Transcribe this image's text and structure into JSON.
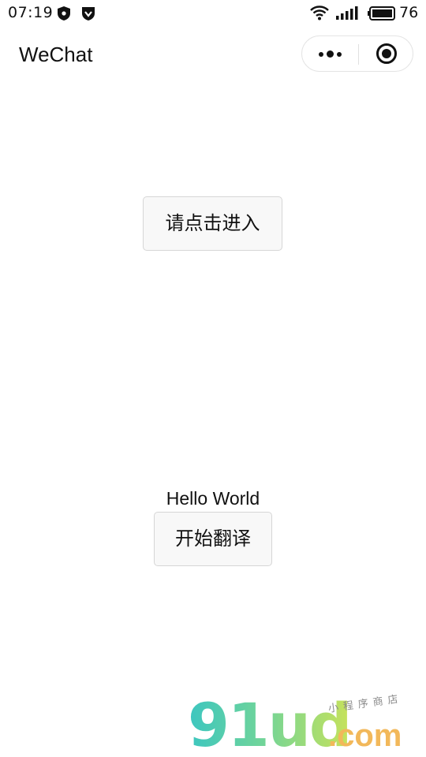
{
  "status_bar": {
    "time": "07:19",
    "battery_level": "76",
    "icons": [
      "shield-icon",
      "shield-check-icon",
      "wifi-icon",
      "signal-icon",
      "battery-icon"
    ]
  },
  "nav": {
    "title": "WeChat",
    "capsule_icons": [
      "more-icon",
      "close-miniprogram-icon"
    ]
  },
  "main": {
    "enter_button_label": "请点击进入",
    "hello_text": "Hello World",
    "translate_button_label": "开始翻译"
  },
  "watermark": {
    "brand": "91ud",
    "domain_suffix": ".com",
    "tagline": "小程序商店"
  },
  "colors": {
    "button_bg": "#f8f8f8",
    "button_border": "#d6d6d6",
    "text": "#111111",
    "watermark_teal": "#3cc6c0",
    "watermark_green": "#c7e25a",
    "watermark_orange": "#f2b85a"
  }
}
